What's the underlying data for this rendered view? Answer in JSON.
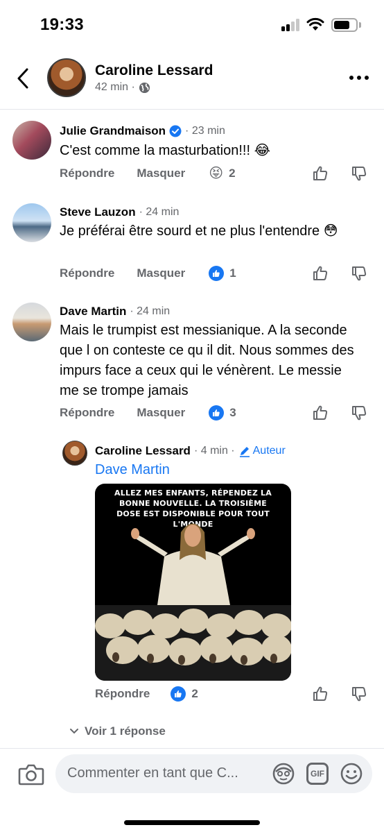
{
  "status_bar": {
    "time": "19:33"
  },
  "header": {
    "name": "Caroline Lessard",
    "meta": "42 min ·"
  },
  "comments": [
    {
      "name": "Julie Grandmaison",
      "time": "· 23 min",
      "text": "C'est comme la masturbation!!! 😂",
      "reply_label": "Répondre",
      "hide_label": "Masquer",
      "reaction_emoji": "😝",
      "reaction_count": "2"
    },
    {
      "name": "Steve Lauzon",
      "time": "· 24 min",
      "text": "Je préférai être sourd et  ne plus l'entendre 😳",
      "reply_label": "Répondre",
      "hide_label": "Masquer",
      "reaction_count": "1"
    },
    {
      "name": "Dave Martin",
      "time": "· 24 min",
      "text": "Mais le trumpist est messianique. A la seconde que l on conteste ce qu il dit. Nous sommes des impurs face a ceux qui le vénèrent.  Le messie me se trompe jamais",
      "reply_label": "Répondre",
      "hide_label": "Masquer",
      "reaction_count": "3"
    }
  ],
  "reply": {
    "name": "Caroline Lessard",
    "time": "· 4 min ·",
    "author_tag": "Auteur",
    "mention": "Dave Martin",
    "meme_text": "ALLEZ MES ENFANTS, RÉPENDEZ LA BONNE NOUVELLE. LA TROISIÈME DOSE EST DISPONIBLE POUR TOUT L'MONDE",
    "reply_label": "Répondre",
    "reaction_count": "2"
  },
  "view_replies": "Voir 1 réponse",
  "composer": {
    "placeholder": "Commenter en tant que C...",
    "gif_label": "GIF"
  },
  "colors": {
    "accent": "#1877f2",
    "muted": "#65676b"
  }
}
